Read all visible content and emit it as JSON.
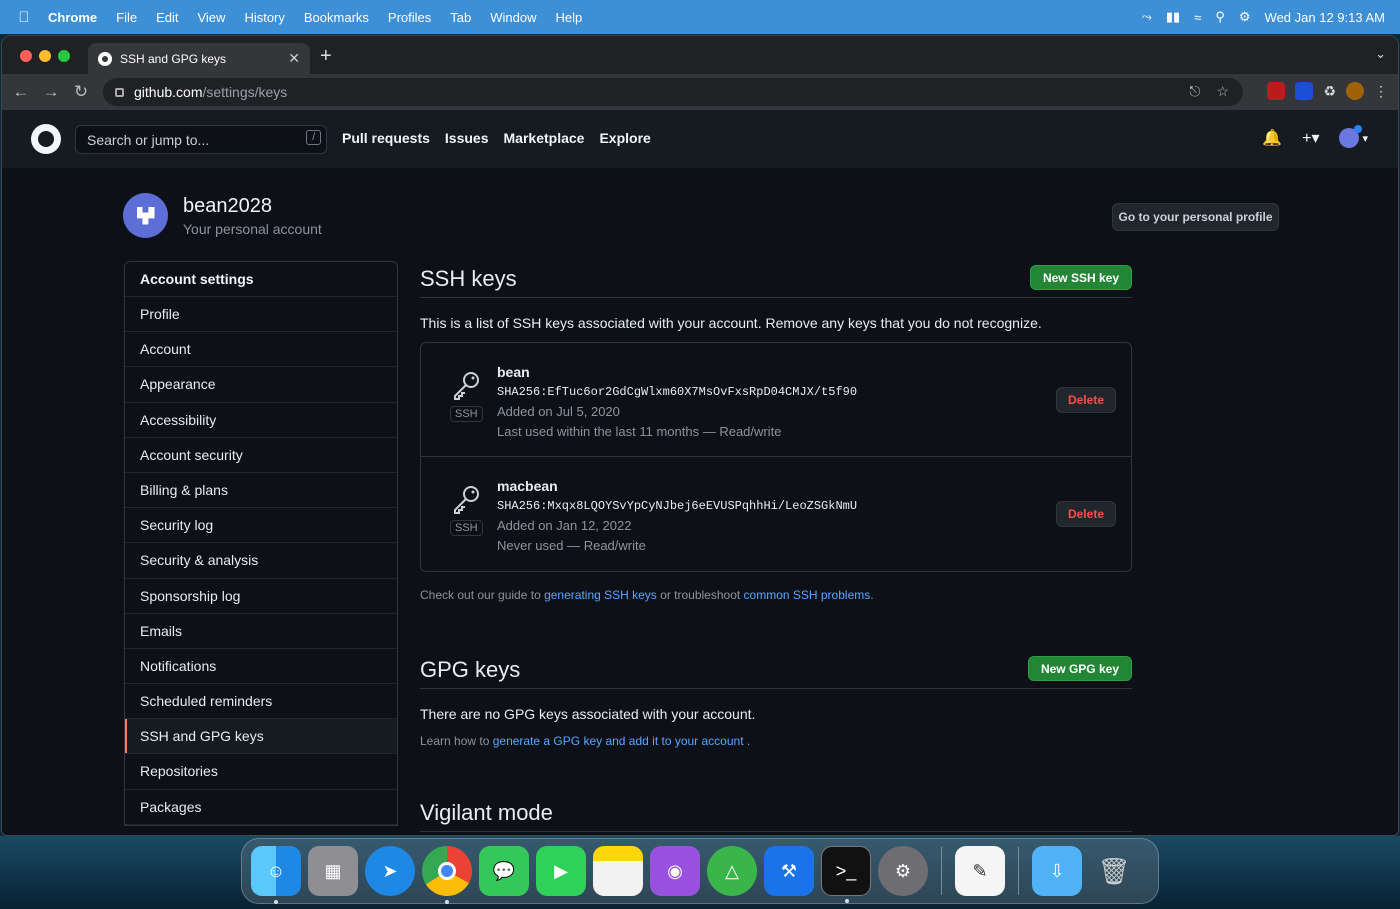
{
  "menubar": {
    "app": "Chrome",
    "items": [
      "File",
      "Edit",
      "View",
      "History",
      "Bookmarks",
      "Profiles",
      "Tab",
      "Window",
      "Help"
    ],
    "datetime": "Wed Jan 12  9:13 AM"
  },
  "browser": {
    "tab_title": "SSH and GPG keys",
    "url_domain": "github.com",
    "url_path": "/settings/keys"
  },
  "github_header": {
    "search_placeholder": "Search or jump to...",
    "search_shortcut": "/",
    "nav": [
      "Pull requests",
      "Issues",
      "Marketplace",
      "Explore"
    ]
  },
  "user": {
    "name": "bean2028",
    "subtitle": "Your personal account",
    "profile_button": "Go to your personal profile"
  },
  "sidebar": {
    "heading": "Account settings",
    "items": [
      "Profile",
      "Account",
      "Appearance",
      "Accessibility",
      "Account security",
      "Billing & plans",
      "Security log",
      "Security & analysis",
      "Sponsorship log",
      "Emails",
      "Notifications",
      "Scheduled reminders",
      "SSH and GPG keys",
      "Repositories",
      "Packages"
    ],
    "active": "SSH and GPG keys"
  },
  "ssh": {
    "title": "SSH keys",
    "new_button": "New SSH key",
    "description": "This is a list of SSH keys associated with your account. Remove any keys that you do not recognize.",
    "badge": "SSH",
    "delete_label": "Delete",
    "keys": [
      {
        "name": "bean",
        "fingerprint": "SHA256:EfTuc6or2GdCgWlxm60X7MsOvFxsRpD04CMJX/t5f90",
        "added": "Added on Jul 5, 2020",
        "usage": "Last used within the last 11 months — Read/write"
      },
      {
        "name": "macbean",
        "fingerprint": "SHA256:Mxqx8LQOYSvYpCyNJbej6eEVUSPqhhHi/LeoZSGkNmU",
        "added": "Added on Jan 12, 2022",
        "usage": "Never used — Read/write"
      }
    ],
    "guide_prefix": "Check out our guide to ",
    "guide_link1": "generating SSH keys",
    "guide_mid": " or troubleshoot ",
    "guide_link2": "common SSH problems",
    "guide_suffix": "."
  },
  "gpg": {
    "title": "GPG keys",
    "new_button": "New GPG key",
    "empty": "There are no GPG keys associated with your account.",
    "learn_prefix": "Learn how to ",
    "learn_link": "generate a GPG key and add it to your account",
    "learn_suffix": " ."
  },
  "vigilant": {
    "title": "Vigilant mode"
  },
  "colors": {
    "accent_green": "#238636",
    "link_blue": "#58a6ff",
    "danger_red": "#f85149",
    "active_marker": "#f78166"
  }
}
